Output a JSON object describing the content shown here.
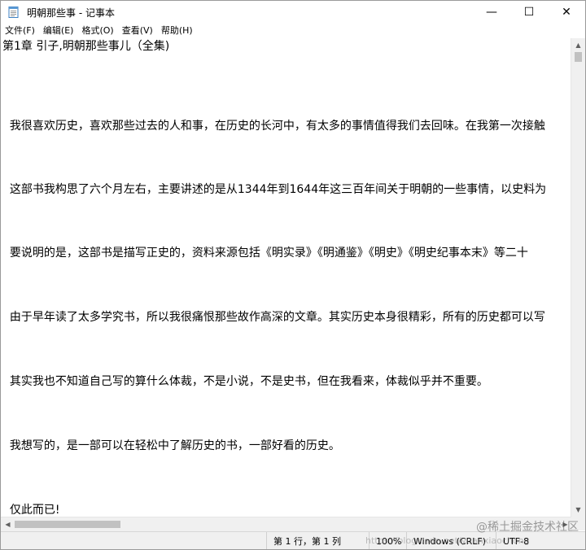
{
  "window": {
    "title": "明朝那些事 - 记事本",
    "minimize_glyph": "—",
    "maximize_glyph": "☐",
    "close_glyph": "✕"
  },
  "menu": [
    {
      "label": "文件(F)"
    },
    {
      "label": "编辑(E)"
    },
    {
      "label": "格式(O)"
    },
    {
      "label": "查看(V)"
    },
    {
      "label": "帮助(H)"
    }
  ],
  "editor": {
    "lines": [
      "第1章 引子,明朝那些事儿（全集)",
      "  我很喜欢历史，喜欢那些过去的人和事，在历史的长河中，有太多的事情值得我们去回味。在我第一次接触",
      "  这部书我构思了六个月左右，主要讲述的是从1344年到1644年这三百年间关于明朝的一些事情，以史料为",
      "  要说明的是，这部书是描写正史的，资料来源包括《明实录》《明通鉴》《明史》《明史纪事本末》等二十",
      "  由于早年读了太多学究书，所以我很痛恨那些故作高深的文章。其实历史本身很精彩，所有的历史都可以写",
      "  其实我也不知道自己写的算什么体裁，不是小说，不是史书，但在我看来，体裁似乎并不重要。",
      "  我想写的，是一部可以在轻松中了解历史的书，一部好看的历史。",
      "  仅此而已!"
    ]
  },
  "statusbar": {
    "position": "第 1 行，第 1 列",
    "zoom": "100%",
    "line_ending": "Windows (CRLF)",
    "encoding": "UTF-8"
  },
  "watermark": {
    "text": "@稀土掘金技术社区",
    "url_text": "https://blog.csdn.net/yuanxiaochong"
  },
  "icons": {
    "app": "notepad-icon",
    "scroll_up": "arrow-up-icon",
    "scroll_down": "arrow-down-icon",
    "scroll_left": "arrow-left-icon",
    "scroll_right": "arrow-right-icon"
  }
}
